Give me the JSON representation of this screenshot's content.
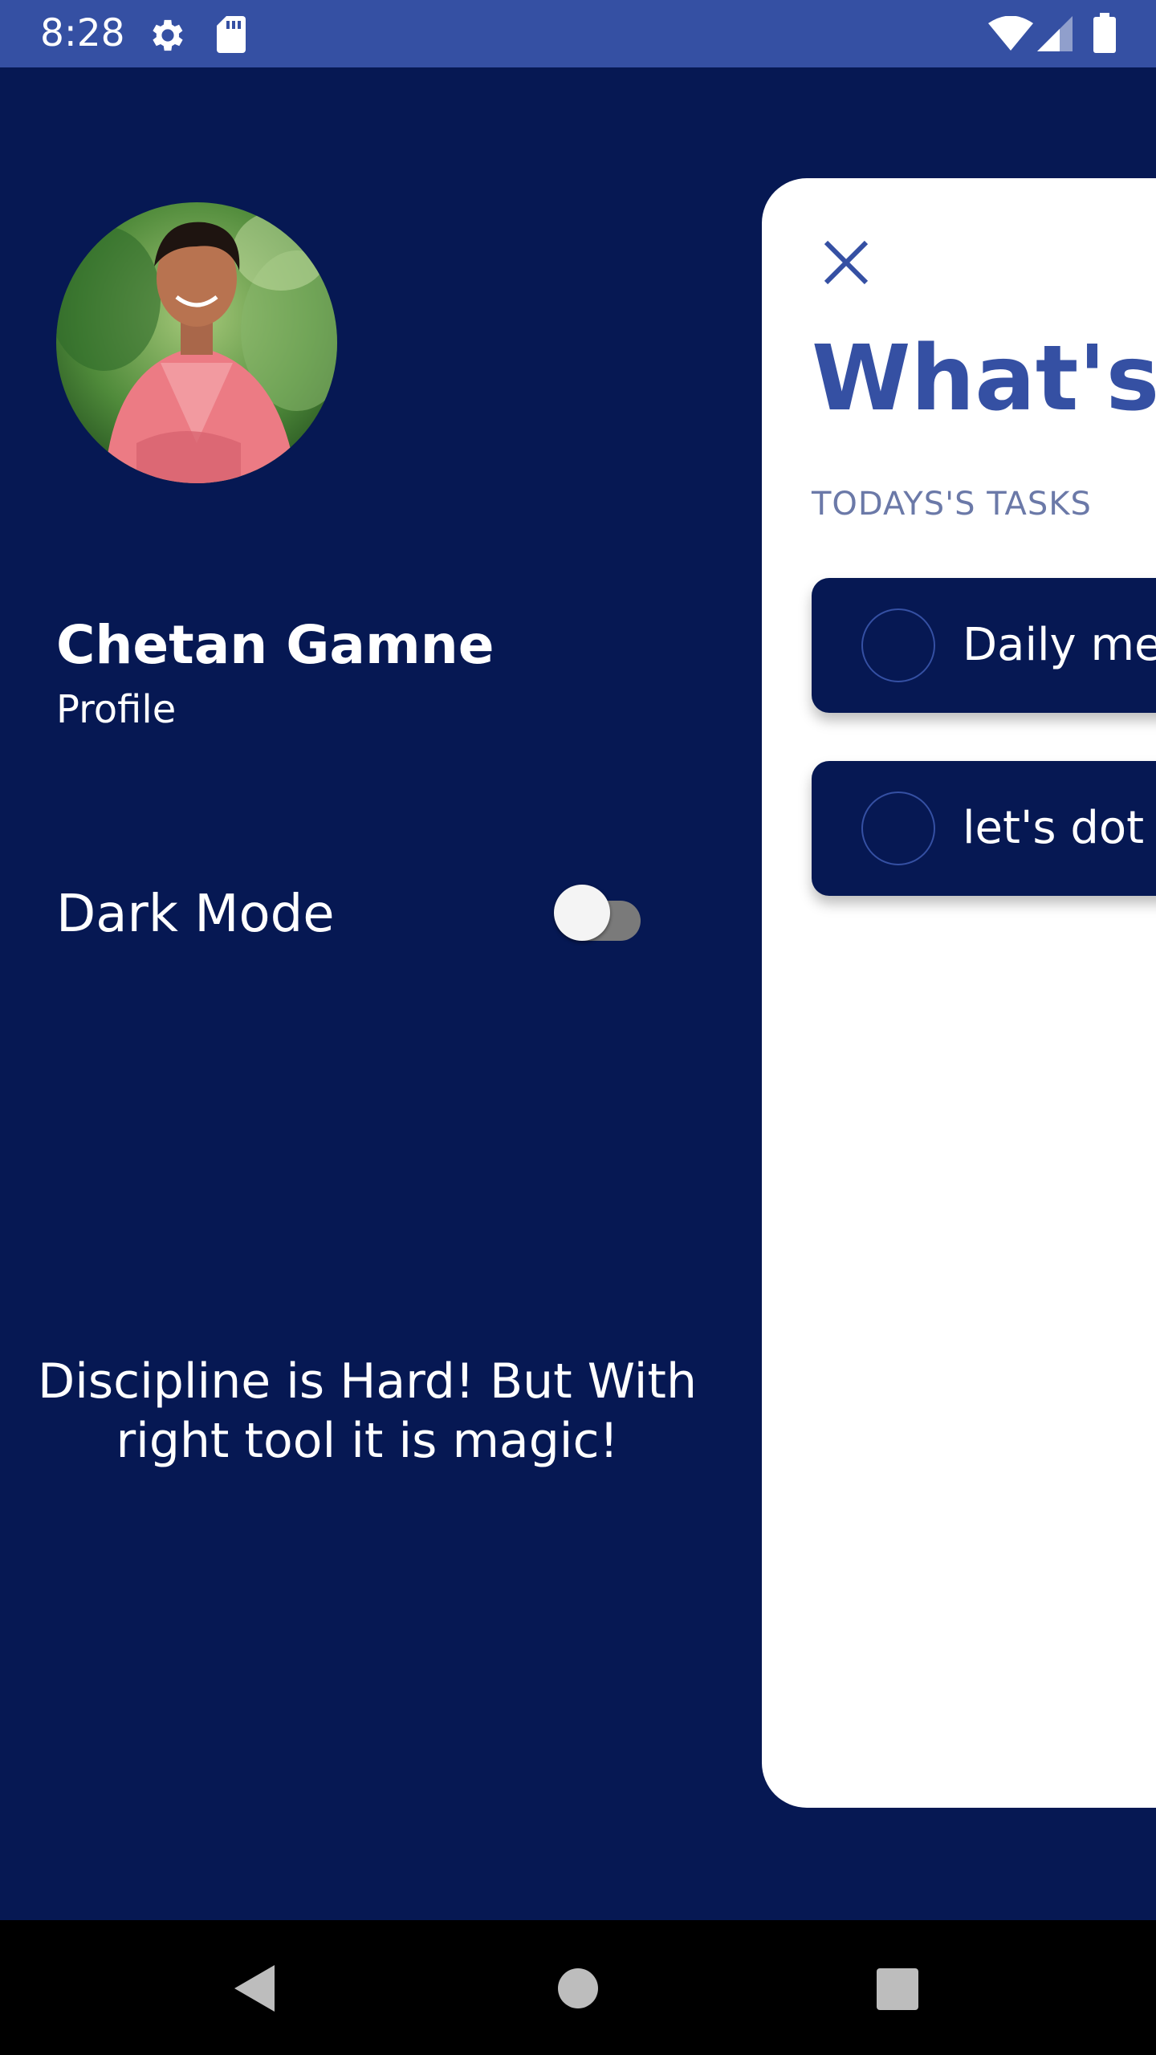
{
  "status_bar": {
    "time": "8:28",
    "icons": [
      "gear-icon",
      "sd-card-icon",
      "wifi-icon",
      "signal-icon",
      "battery-icon"
    ]
  },
  "drawer": {
    "avatar_alt": "profile-photo",
    "name": "Chetan Gamne",
    "profile_link": "Profile",
    "dark_mode_label": "Dark Mode",
    "dark_mode_enabled": false,
    "quote": "Discipline is Hard! But With right tool it is magic!"
  },
  "main": {
    "title": "What's up",
    "section_label": "TODAYS'S TASKS",
    "tasks": [
      {
        "text": "Daily meet",
        "done": false
      },
      {
        "text": "let's dot se",
        "done": false
      }
    ]
  },
  "nav_bar": {
    "buttons": [
      "back-icon",
      "home-icon",
      "recents-icon"
    ]
  },
  "colors": {
    "background": "#061853",
    "accent": "#3550a3",
    "card": "#ffffff",
    "section_label": "#6b79a8"
  }
}
